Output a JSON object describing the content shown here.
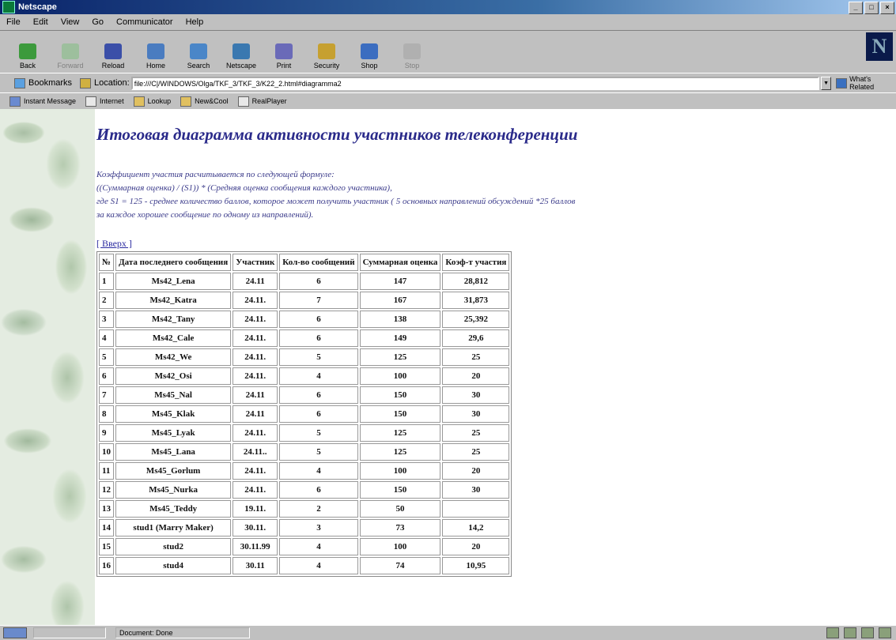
{
  "window": {
    "title": "Netscape"
  },
  "menu": [
    "File",
    "Edit",
    "View",
    "Go",
    "Communicator",
    "Help"
  ],
  "toolbar": [
    "Back",
    "Forward",
    "Reload",
    "Home",
    "Search",
    "Netscape",
    "Print",
    "Security",
    "Shop",
    "Stop"
  ],
  "location": {
    "bookmarks_label": "Bookmarks",
    "location_label": "Location:",
    "url": "file:///C|/WINDOWS/Olga/TKF_3/TKF_3/K22_2.html#diagramma2",
    "related_label": "What's Related"
  },
  "personal": [
    "Instant Message",
    "Internet",
    "Lookup",
    "New&Cool",
    "RealPlayer"
  ],
  "page": {
    "title": "Итоговая диаграмма активности участников телеконференции",
    "formula_lines": [
      "Коэффициент участия расчитывается по следующей формуле:",
      "((Суммарная оценка) / (S1)) * (Средняя оценка сообщения каждого участника),",
      "где S1 = 125 - среднее количество баллов, которое может получить участник ( 5 основных направлений обсуждений *25 баллов",
      "за каждое хорошее сообщение по одному из направлений)."
    ],
    "top_link": "[ Вверх ]"
  },
  "table": {
    "headers": [
      "№",
      "Дата последнего сообщения",
      "Участник",
      "Кол-во сообщений",
      "Суммарная оценка",
      "Коэф-т участия"
    ],
    "rows": [
      [
        "1",
        "Ms42_Lena",
        "24.11",
        "6",
        "147",
        "28,812"
      ],
      [
        "2",
        "Ms42_Katra",
        "24.11.",
        "7",
        "167",
        "31,873"
      ],
      [
        "3",
        "Ms42_Tany",
        "24.11.",
        "6",
        "138",
        "25,392"
      ],
      [
        "4",
        "Ms42_Cale",
        "24.11.",
        "6",
        "149",
        "29,6"
      ],
      [
        "5",
        "Ms42_We",
        "24.11.",
        "5",
        "125",
        "25"
      ],
      [
        "6",
        "Ms42_Osi",
        "24.11.",
        "4",
        "100",
        "20"
      ],
      [
        "7",
        "Ms45_Nal",
        "24.11",
        "6",
        "150",
        "30"
      ],
      [
        "8",
        "Ms45_Klak",
        "24.11",
        "6",
        "150",
        "30"
      ],
      [
        "9",
        "Ms45_Lyak",
        "24.11.",
        "5",
        "125",
        "25"
      ],
      [
        "10",
        "Ms45_Lana",
        "24.11..",
        "5",
        "125",
        "25"
      ],
      [
        "11",
        "Ms45_Gorlum",
        "24.11.",
        "4",
        "100",
        "20"
      ],
      [
        "12",
        "Ms45_Nurka",
        "24.11.",
        "6",
        "150",
        "30"
      ],
      [
        "13",
        "Ms45_Teddy",
        "19.11.",
        "2",
        "50",
        ""
      ],
      [
        "14",
        "stud1 (Marry Maker)",
        "30.11.",
        "3",
        "73",
        "14,2"
      ],
      [
        "15",
        "stud2",
        "30.11.99",
        "4",
        "100",
        "20"
      ],
      [
        "16",
        "stud4",
        "30.11",
        "4",
        "74",
        "10,95"
      ]
    ]
  },
  "status": {
    "text": "Document: Done"
  }
}
